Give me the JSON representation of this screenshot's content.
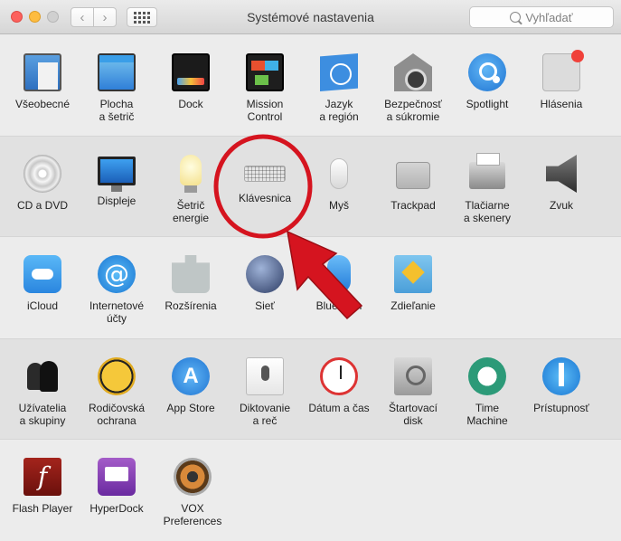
{
  "window": {
    "title": "Systémové nastavenia"
  },
  "toolbar": {
    "back_glyph": "‹",
    "forward_glyph": "›"
  },
  "search": {
    "placeholder": "Vyhľadať"
  },
  "rows": [
    [
      {
        "label": "Všeobecné",
        "icon": "general-icon"
      },
      {
        "label": "Plocha\na šetrič",
        "icon": "desktop-icon"
      },
      {
        "label": "Dock",
        "icon": "dock-icon"
      },
      {
        "label": "Mission\nControl",
        "icon": "mission-control-icon"
      },
      {
        "label": "Jazyk\na región",
        "icon": "language-icon"
      },
      {
        "label": "Bezpečnosť\na súkromie",
        "icon": "security-icon"
      },
      {
        "label": "Spotlight",
        "icon": "spotlight-icon"
      },
      {
        "label": "Hlásenia",
        "icon": "notifications-icon"
      }
    ],
    [
      {
        "label": "CD a DVD",
        "icon": "cd-icon"
      },
      {
        "label": "Displeje",
        "icon": "display-icon"
      },
      {
        "label": "Šetrič\nenergie",
        "icon": "energy-icon"
      },
      {
        "label": "Klávesnica",
        "icon": "keyboard-icon"
      },
      {
        "label": "Myš",
        "icon": "mouse-icon"
      },
      {
        "label": "Trackpad",
        "icon": "trackpad-icon"
      },
      {
        "label": "Tlačiarne\na skenery",
        "icon": "printer-icon"
      },
      {
        "label": "Zvuk",
        "icon": "sound-icon"
      }
    ],
    [
      {
        "label": "iCloud",
        "icon": "icloud-icon"
      },
      {
        "label": "Internetové\núčty",
        "icon": "internet-accounts-icon"
      },
      {
        "label": "Rozšírenia",
        "icon": "extensions-icon"
      },
      {
        "label": "Sieť",
        "icon": "network-icon"
      },
      {
        "label": "Bluetooth",
        "icon": "bluetooth-icon"
      },
      {
        "label": "Zdieľanie",
        "icon": "sharing-icon"
      }
    ],
    [
      {
        "label": "Užívatelia\na skupiny",
        "icon": "users-icon"
      },
      {
        "label": "Rodičovská\nochrana",
        "icon": "parental-icon"
      },
      {
        "label": "App Store",
        "icon": "app-store-icon"
      },
      {
        "label": "Diktovanie\na reč",
        "icon": "dictation-icon"
      },
      {
        "label": "Dátum a čas",
        "icon": "date-time-icon"
      },
      {
        "label": "Štartovací\ndisk",
        "icon": "startup-disk-icon"
      },
      {
        "label": "Time\nMachine",
        "icon": "time-machine-icon"
      },
      {
        "label": "Prístupnosť",
        "icon": "accessibility-icon"
      }
    ],
    [
      {
        "label": "Flash Player",
        "icon": "flash-icon"
      },
      {
        "label": "HyperDock",
        "icon": "hyperdock-icon"
      },
      {
        "label": "VOX Preferences",
        "icon": "vox-icon"
      }
    ]
  ],
  "icon_text": {
    "internet": "@",
    "appstore": "A",
    "flash": "f"
  },
  "colors": {
    "annotation_red": "#d5141f",
    "close": "#fc605c",
    "minimize": "#fdbc40"
  }
}
